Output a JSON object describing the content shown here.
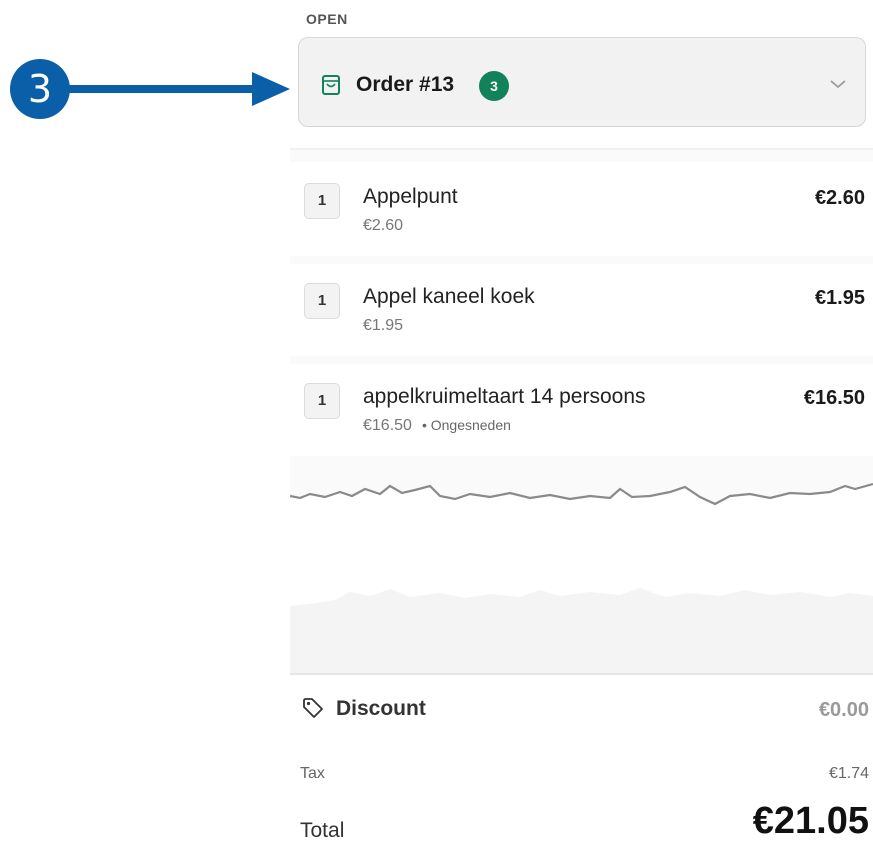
{
  "callout": {
    "number": "3"
  },
  "order": {
    "status": "OPEN",
    "title": "Order #13",
    "item_count": "3"
  },
  "items": [
    {
      "qty": "1",
      "name": "Appelpunt",
      "unit_price": "€2.60",
      "note": "",
      "price": "€2.60"
    },
    {
      "qty": "1",
      "name": "Appel kaneel koek",
      "unit_price": "€1.95",
      "note": "",
      "price": "€1.95"
    },
    {
      "qty": "1",
      "name": "appelkruimeltaart 14 persoons",
      "unit_price": "€16.50",
      "note": "• Ongesneden",
      "price": "€16.50"
    }
  ],
  "summary": {
    "discount_label": "Discount",
    "discount_value": "€0.00",
    "tax_label": "Tax",
    "tax_value": "€1.74",
    "total_label": "Total",
    "total_value": "€21.05"
  },
  "colors": {
    "accent_green": "#11825a",
    "callout_blue": "#0b5fa8"
  },
  "icons": [
    "shopping-bag-icon",
    "chevron-down-icon",
    "tag-icon",
    "arrow-right-icon"
  ]
}
